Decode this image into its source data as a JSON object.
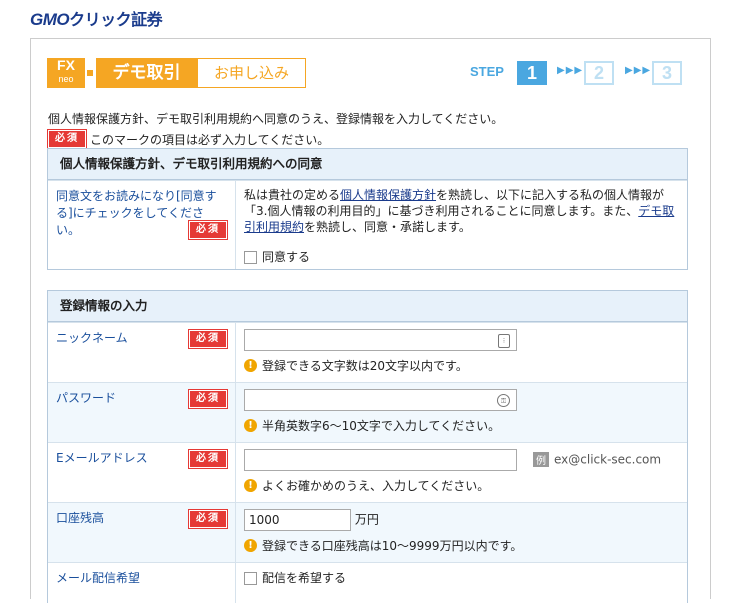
{
  "logo": {
    "gmo": "GMO",
    "rest": "クリック証券"
  },
  "brand": {
    "fx": "FX",
    "neo": "neo",
    "demo": "デモ取引",
    "apply": "お申し込み"
  },
  "steps": {
    "label": "STEP",
    "items": [
      "1",
      "2",
      "3"
    ],
    "active": 1
  },
  "intro_text": "個人情報保護方針、デモ取引利用規約へ同意のうえ、登録情報を入力してください。",
  "required_badge": "必須",
  "required_note": "このマークの項目は必ず入力してください。",
  "agreement": {
    "heading": "個人情報保護方針、デモ取引利用規約への同意",
    "label": "同意文をお読みになり[同意する]にチェックをしてください。",
    "text_1": "私は貴社の定める",
    "link_1": "個人情報保護方針",
    "text_2": "を熟読し、以下に記入する私の個人情報が「3.個人情報の利用目的」に基づき利用されることに同意します。また、",
    "link_2": "デモ取引利用規約",
    "text_3": "を熟読し、同意・承諾します。",
    "checkbox_label": "同意する"
  },
  "registration": {
    "heading": "登録情報の入力",
    "nickname": {
      "label": "ニックネーム",
      "value": "",
      "note": "登録できる文字数は20文字以内です。"
    },
    "password": {
      "label": "パスワード",
      "value": "",
      "note": "半角英数字6～10文字で入力してください。"
    },
    "email": {
      "label": "Eメールアドレス",
      "value": "",
      "example_tag": "例",
      "example": "ex@click-sec.com",
      "note": "よくお確かめのうえ、入力してください。"
    },
    "balance": {
      "label": "口座残高",
      "value": "1000",
      "unit": "万円",
      "note": "登録できる口座残高は10～9999万円以内です。"
    },
    "mail": {
      "label": "メール配信希望",
      "checkbox_label": "配信を希望する"
    }
  },
  "colors": {
    "brand_orange": "#f5a623",
    "step_blue": "#4aa7e0",
    "required_red": "#e53935",
    "header_bg": "#e7f1fa"
  }
}
